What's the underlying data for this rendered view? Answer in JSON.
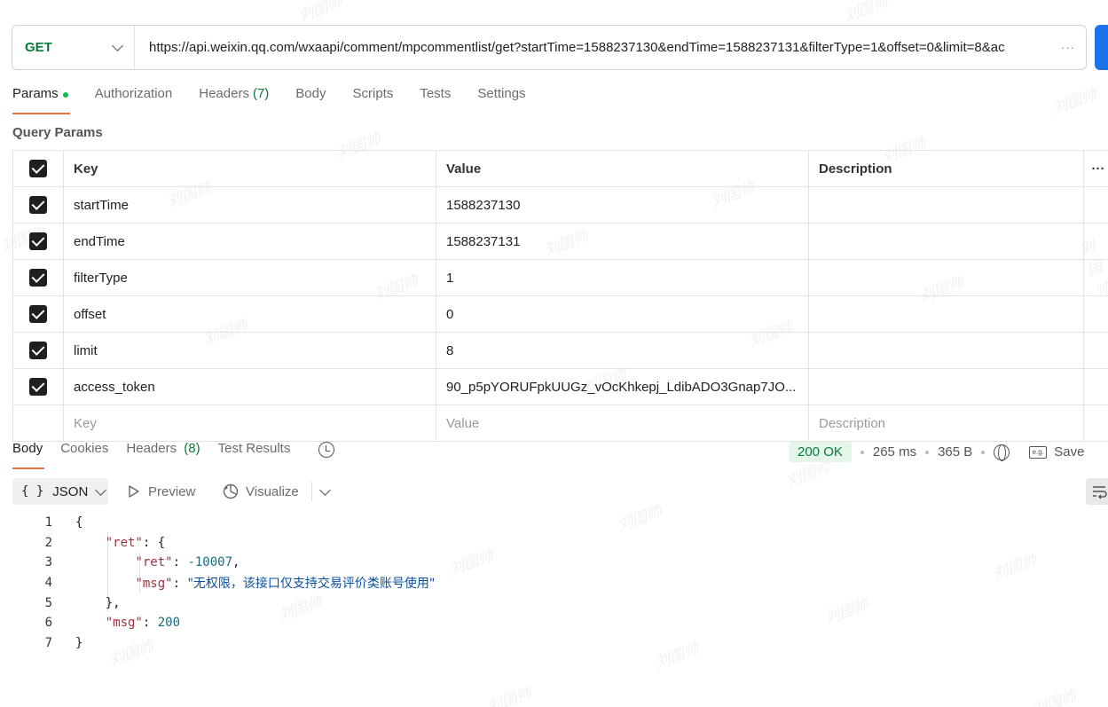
{
  "request": {
    "method": "GET",
    "url": "https://api.weixin.qq.com/wxaapi/comment/mpcommentlist/get?startTime=1588237130&endTime=1588237131&filterType=1&offset=0&limit=8&ac",
    "url_more": "···"
  },
  "request_tabs": {
    "params": "Params",
    "authorization": "Authorization",
    "headers": "Headers",
    "headers_count": "(7)",
    "body": "Body",
    "scripts": "Scripts",
    "tests": "Tests",
    "settings": "Settings"
  },
  "query_params": {
    "title": "Query Params",
    "columns": {
      "key": "Key",
      "value": "Value",
      "description": "Description",
      "more": "···"
    },
    "rows": [
      {
        "key": "startTime",
        "value": "1588237130",
        "checked": true
      },
      {
        "key": "endTime",
        "value": "1588237131",
        "checked": true
      },
      {
        "key": "filterType",
        "value": "1",
        "checked": true
      },
      {
        "key": "offset",
        "value": "0",
        "checked": true
      },
      {
        "key": "limit",
        "value": "8",
        "checked": true
      },
      {
        "key": "access_token",
        "value": "90_p5pYORUFpkUUGz_vOcKhkepj_LdibADO3Gnap7JO...",
        "checked": true
      }
    ],
    "placeholder": {
      "key": "Key",
      "value": "Value",
      "description": "Description"
    }
  },
  "response_tabs": {
    "body": "Body",
    "cookies": "Cookies",
    "headers": "Headers",
    "headers_count": "(8)",
    "test_results": "Test Results"
  },
  "response_status": {
    "status": "200 OK",
    "time": "265 ms",
    "size": "365 B",
    "save": "Save",
    "save_icon_text": "e.g."
  },
  "response_toolbar": {
    "braces": "{ }",
    "format": "JSON",
    "preview": "Preview",
    "visualize": "Visualize"
  },
  "response_body": {
    "lines": [
      "1",
      "2",
      "3",
      "4",
      "5",
      "6",
      "7"
    ],
    "outer_ret_key": "\"ret\"",
    "inner_ret_key": "\"ret\"",
    "inner_ret_value": "-10007",
    "inner_msg_key": "\"msg\"",
    "inner_msg_value": "\"无权限，该接口仅支持交易评价类账号使用\"",
    "outer_msg_key": "\"msg\"",
    "outer_msg_value": "200"
  },
  "watermark": "刘国帅",
  "colors": {
    "accent": "#f26b3a",
    "method_green": "#0b7a3b",
    "send_blue": "#1a73e8",
    "status_bg": "#e3f6e9"
  }
}
